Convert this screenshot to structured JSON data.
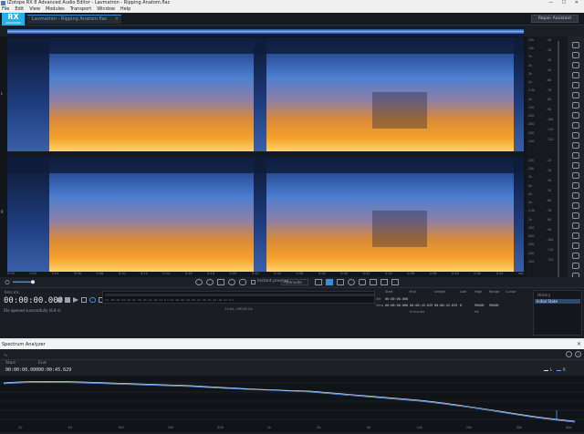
{
  "window": {
    "title": "iZotope RX 8 Advanced Audio Editor - Lavmatron - Ripping Anatom.flac",
    "controls": "— ☐ ✕"
  },
  "menu": [
    "File",
    "Edit",
    "View",
    "Modules",
    "Transport",
    "Window",
    "Help"
  ],
  "logo": {
    "main": "RX",
    "sub": "ADVANCED"
  },
  "file_tab": {
    "label": "Lavmatron - Ripping Anatom.flac",
    "close": "×"
  },
  "repair_assistant": "Repair Assistant",
  "channels": {
    "left": "L",
    "right": "R"
  },
  "freq_ruler": {
    "ch1": [
      "-15k",
      "-10k",
      "-7k",
      "-5k",
      "-3k",
      "-2k",
      "-1.5k",
      "-1k",
      "-700",
      "-500",
      "-300",
      "-200",
      "-100"
    ],
    "ch2": [
      "-15k",
      "-10k",
      "-7k",
      "-5k",
      "-3k",
      "-2k",
      "-1.5k",
      "-1k",
      "-700",
      "-500",
      "-300",
      "-200",
      "-100"
    ]
  },
  "db_ruler": {
    "ch1": [
      "-20",
      "-30",
      "-40",
      "-50",
      "-60",
      "-70",
      "-80",
      "-90",
      "-100",
      "-110",
      "-120"
    ],
    "ch2": [
      "-20",
      "-30",
      "-40",
      "-50",
      "-60",
      "-70",
      "-80",
      "-90",
      "-100",
      "-110",
      "-120"
    ]
  },
  "time_ruler": [
    "0:00",
    "0:02",
    "0:04",
    "0:06",
    "0:08",
    "0:10",
    "0:12",
    "0:14",
    "0:16",
    "0:18",
    "0:20",
    "0:22",
    "0:24",
    "0:26",
    "0:28",
    "0:30",
    "0:32",
    "0:34",
    "0:36",
    "0:38",
    "0:40",
    "0:42",
    "0:44",
    "sec"
  ],
  "toolbar": {
    "instant_process": "Instant process",
    "mode": "Attenuate"
  },
  "transport": {
    "time_format": "hms.ms",
    "timecode": "00:00:00.000",
    "status": "File opened successfully (6.9 s)",
    "meter_scale": "Inf. -66 -60 -54 -48 -42 -36 -30 -24 -18 -12 -6 0 Inf. -66 -60 -54 -48 -42 -36 -30 -24 -18 -12 -6 0",
    "meter_info": "24 bit | 96000 Hz"
  },
  "selection": {
    "headers": [
      "Start",
      "End",
      "Length",
      "Low",
      "High",
      "Range",
      "Cursor"
    ],
    "sel_label": "Sel",
    "view_label": "View",
    "sel_values": [
      "00:00:00.000",
      "",
      "",
      "",
      "",
      "",
      ""
    ],
    "view_values": [
      "00:00:00.000",
      "00:00:45.629",
      "00:00:45.629",
      "0",
      "96000",
      "96000",
      ""
    ],
    "format": "h:m:s.ms",
    "unit": "Hz"
  },
  "history": {
    "label": "History",
    "item": "Initial State"
  },
  "spectrum_analyzer": {
    "title": "Spectrum Analyzer",
    "close": "✕",
    "start_label": "Start",
    "start_value": "00:00:00.000",
    "end_label": "End",
    "end_value": "00:00:45.629",
    "legend": [
      "L",
      "R"
    ],
    "db_labels": [
      "0",
      "-10",
      "-20",
      "-30",
      "-40",
      "-50",
      "-60",
      "-70",
      "-80",
      "-90"
    ],
    "freq_labels": [
      "20",
      "50",
      "100",
      "200",
      "500",
      "1k",
      "2k",
      "5k",
      "10k",
      "20k",
      "30k",
      "40k"
    ]
  },
  "colors": {
    "accent": "#3d8ed6",
    "spectrum_orange": "#f08a1c",
    "spectrum_blue": "#3a6fc4",
    "curve": "#d8dde6"
  },
  "icons": [
    "search-icon",
    "zoom-in-icon",
    "zoom-out-icon",
    "hand-icon",
    "lasso-icon",
    "brush-icon",
    "wand-icon",
    "play-icon",
    "stop-icon",
    "record-icon",
    "loop-icon",
    "gear-icon",
    "info-icon"
  ]
}
